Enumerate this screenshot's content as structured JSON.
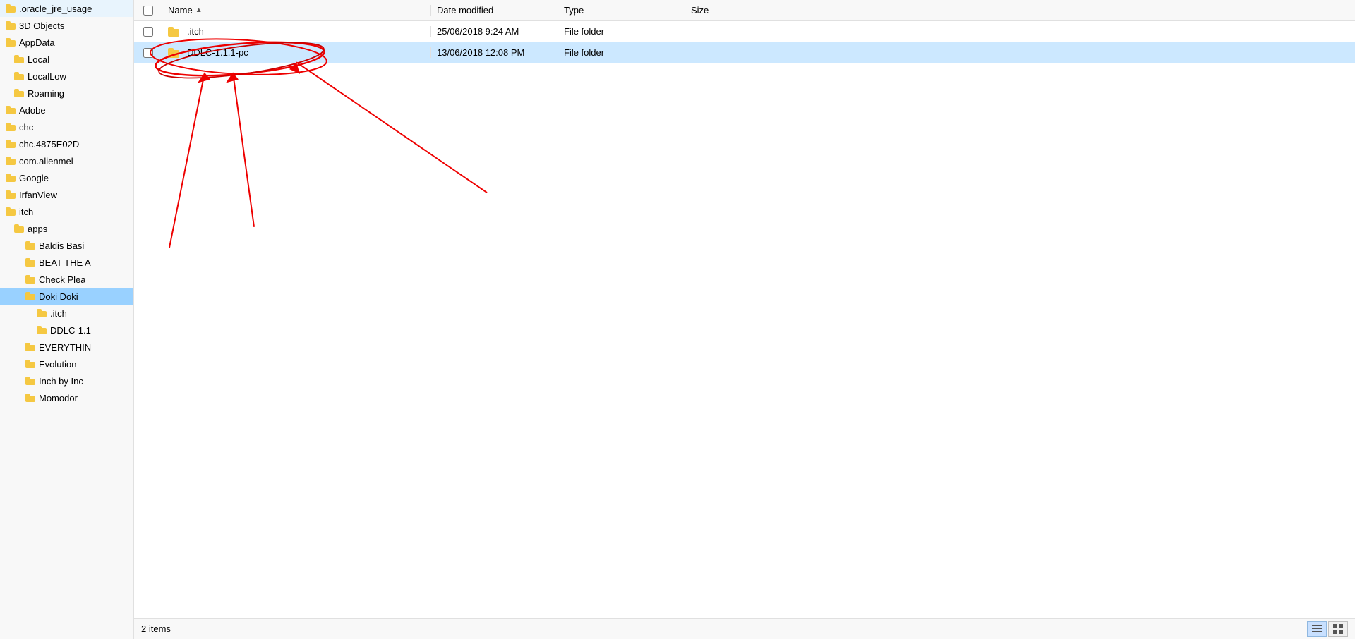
{
  "sidebar": {
    "items": [
      {
        "id": "oracle_jre",
        "label": ".oracle_jre_usage",
        "indent": 0,
        "selected": false
      },
      {
        "id": "3d_objects",
        "label": "3D Objects",
        "indent": 0,
        "selected": false
      },
      {
        "id": "appdata",
        "label": "AppData",
        "indent": 0,
        "selected": false
      },
      {
        "id": "local",
        "label": "Local",
        "indent": 1,
        "selected": false
      },
      {
        "id": "locallow",
        "label": "LocalLow",
        "indent": 1,
        "selected": false
      },
      {
        "id": "roaming",
        "label": "Roaming",
        "indent": 1,
        "selected": false
      },
      {
        "id": "adobe",
        "label": "Adobe",
        "indent": 0,
        "selected": false
      },
      {
        "id": "chc",
        "label": "chc",
        "indent": 0,
        "selected": false
      },
      {
        "id": "chc4875",
        "label": "chc.4875E02D",
        "indent": 0,
        "selected": false
      },
      {
        "id": "com_alien",
        "label": "com.alienmel",
        "indent": 0,
        "selected": false
      },
      {
        "id": "google",
        "label": "Google",
        "indent": 0,
        "selected": false
      },
      {
        "id": "irfanview",
        "label": "IrfanView",
        "indent": 0,
        "selected": false
      },
      {
        "id": "itch",
        "label": "itch",
        "indent": 0,
        "selected": false
      },
      {
        "id": "apps",
        "label": "apps",
        "indent": 1,
        "selected": false
      },
      {
        "id": "baldis_basi",
        "label": "Baldis Basi",
        "indent": 2,
        "selected": false
      },
      {
        "id": "beat_the",
        "label": "BEAT THE A",
        "indent": 2,
        "selected": false
      },
      {
        "id": "check_plea",
        "label": "Check Plea",
        "indent": 2,
        "selected": false
      },
      {
        "id": "doki_doki",
        "label": "Doki Doki",
        "indent": 2,
        "selected": true,
        "selected_dark": true
      },
      {
        "id": "dot_itch",
        "label": ".itch",
        "indent": 3,
        "selected": false
      },
      {
        "id": "ddlc_1",
        "label": "DDLC-1.1",
        "indent": 3,
        "selected": false
      },
      {
        "id": "everything",
        "label": "EVERYTHIN",
        "indent": 2,
        "selected": false
      },
      {
        "id": "evolution",
        "label": "Evolution",
        "indent": 2,
        "selected": false
      },
      {
        "id": "inch_by_inc",
        "label": "Inch by Inc",
        "indent": 2,
        "selected": false
      },
      {
        "id": "momodor",
        "label": "Momodor",
        "indent": 2,
        "selected": false
      }
    ]
  },
  "columns": {
    "name": "Name",
    "date_modified": "Date modified",
    "type": "Type",
    "size": "Size"
  },
  "files": [
    {
      "id": "dot_itch_folder",
      "name": ".itch",
      "date_modified": "25/06/2018 9:24 AM",
      "type": "File folder",
      "size": "",
      "selected": false
    },
    {
      "id": "ddlc_folder",
      "name": "DDLC-1.1.1-pc",
      "date_modified": "13/06/2018 12:08 PM",
      "type": "File folder",
      "size": "",
      "selected": true
    }
  ],
  "status": {
    "items_count": "2 items"
  },
  "annotations": {
    "circle_label": "circled annotation around DDLC-1.1.1-pc folder",
    "arrows_label": "red arrows pointing to DDLC-1.1.1-pc folder"
  }
}
